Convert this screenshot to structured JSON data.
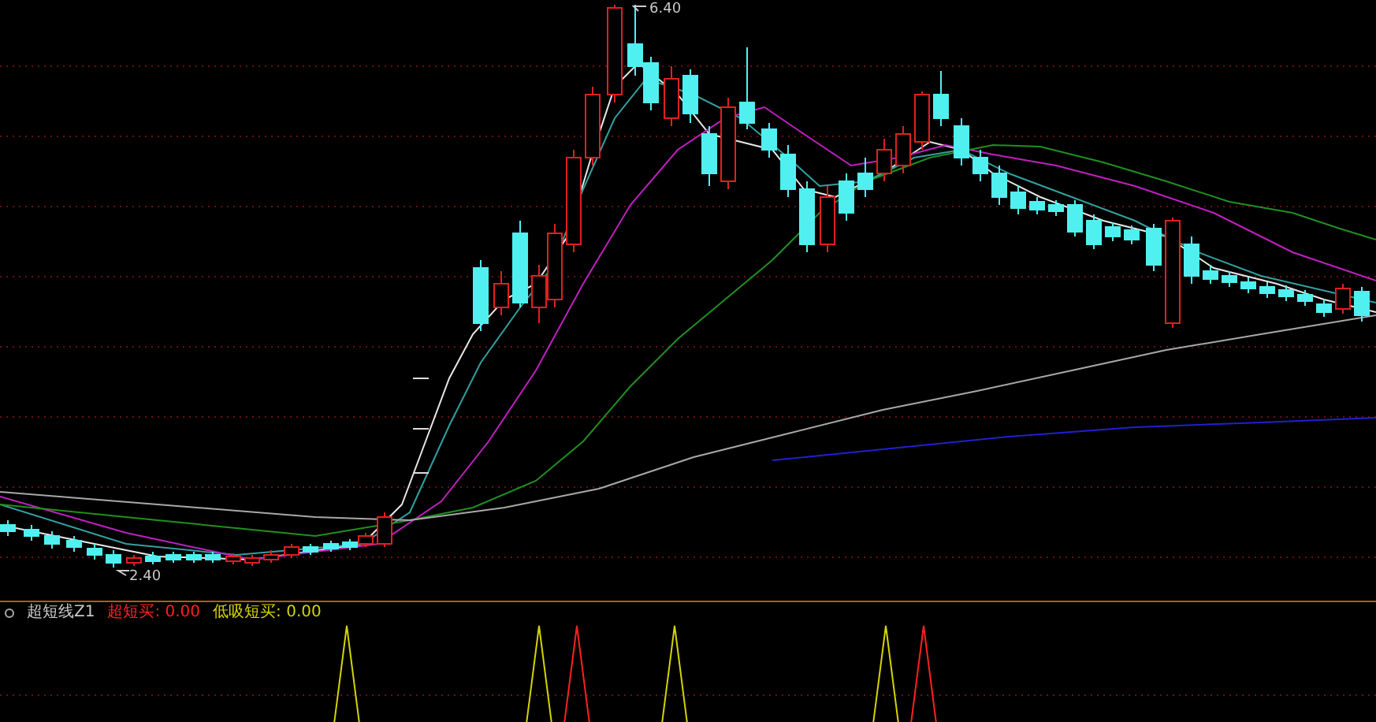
{
  "main_chart": {
    "high_label": "6.40",
    "low_label": "2.40"
  },
  "indicator": {
    "name": "超短线Z1",
    "values": [
      {
        "label": "超短买:",
        "value": "0.00",
        "color": "#ff2020"
      },
      {
        "label": "低吸短买:",
        "value": "0.00",
        "color": "#d4d400"
      }
    ]
  }
}
